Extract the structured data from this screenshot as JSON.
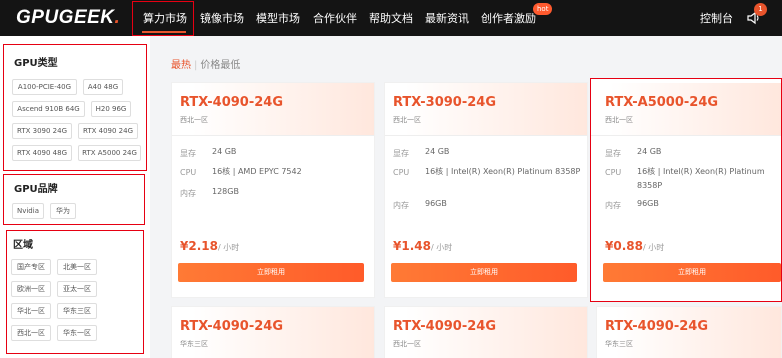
{
  "nav": {
    "logo_main": "GPUGEEK",
    "logo_dot": ".",
    "items": [
      "算力市场",
      "镜像市场",
      "模型市场",
      "合作伙伴",
      "帮助文档",
      "最新资讯",
      "创作者激励"
    ],
    "hot_badge": "hot",
    "console": "控制台",
    "notification_count": "1"
  },
  "sidebar": {
    "gpu_type": {
      "title": "GPU类型",
      "tags": [
        "A100-PCIE-40G",
        "A40 48G",
        "Ascend 910B 64G",
        "H20 96G",
        "RTX 3090 24G",
        "RTX 4090 24G",
        "RTX 4090 48G",
        "RTX A5000 24G"
      ]
    },
    "gpu_brand": {
      "title": "GPU品牌",
      "tags": [
        "Nvidia",
        "华为"
      ]
    },
    "region": {
      "title": "区域",
      "tags": [
        "国产专区",
        "北美一区",
        "欧洲一区",
        "亚太一区",
        "华北一区",
        "华东三区",
        "西北一区",
        "华东一区"
      ]
    }
  },
  "sort": {
    "active": "最热",
    "separator": "|",
    "other": "价格最低"
  },
  "cards": [
    {
      "title": "RTX-4090-24G",
      "region": "西北一区",
      "specs": [
        {
          "label": "显存",
          "value": "24 GB"
        },
        {
          "label": "CPU",
          "value": "16核 | AMD EPYC 7542"
        },
        {
          "label": "内存",
          "value": "128GB"
        }
      ],
      "price": "¥2.18",
      "price_unit": "/ 小时",
      "button": "立即租用"
    },
    {
      "title": "RTX-3090-24G",
      "region": "西北一区",
      "specs": [
        {
          "label": "显存",
          "value": "24 GB"
        },
        {
          "label": "CPU",
          "value": "16核 | Intel(R) Xeon(R) Platinum 8358P"
        },
        {
          "label": "内存",
          "value": "96GB"
        }
      ],
      "price": "¥1.48",
      "price_unit": "/ 小时",
      "button": "立即租用"
    },
    {
      "title": "RTX-A5000-24G",
      "region": "西北一区",
      "specs": [
        {
          "label": "显存",
          "value": "24 GB"
        },
        {
          "label": "CPU",
          "value": "16核 | Intel(R) Xeon(R) Platinum 8358P"
        },
        {
          "label": "内存",
          "value": "96GB"
        }
      ],
      "price": "¥0.88",
      "price_unit": "/ 小时",
      "button": "立即租用"
    },
    {
      "title": "RTX-4090-24G",
      "region": "华东三区"
    },
    {
      "title": "RTX-4090-24G",
      "region": "西北一区"
    },
    {
      "title": "RTX-4090-24G",
      "region": "华东三区"
    }
  ],
  "colors": {
    "accent": "#e8542c",
    "highlight_border": "#e60012",
    "nav_bg": "#141414"
  }
}
